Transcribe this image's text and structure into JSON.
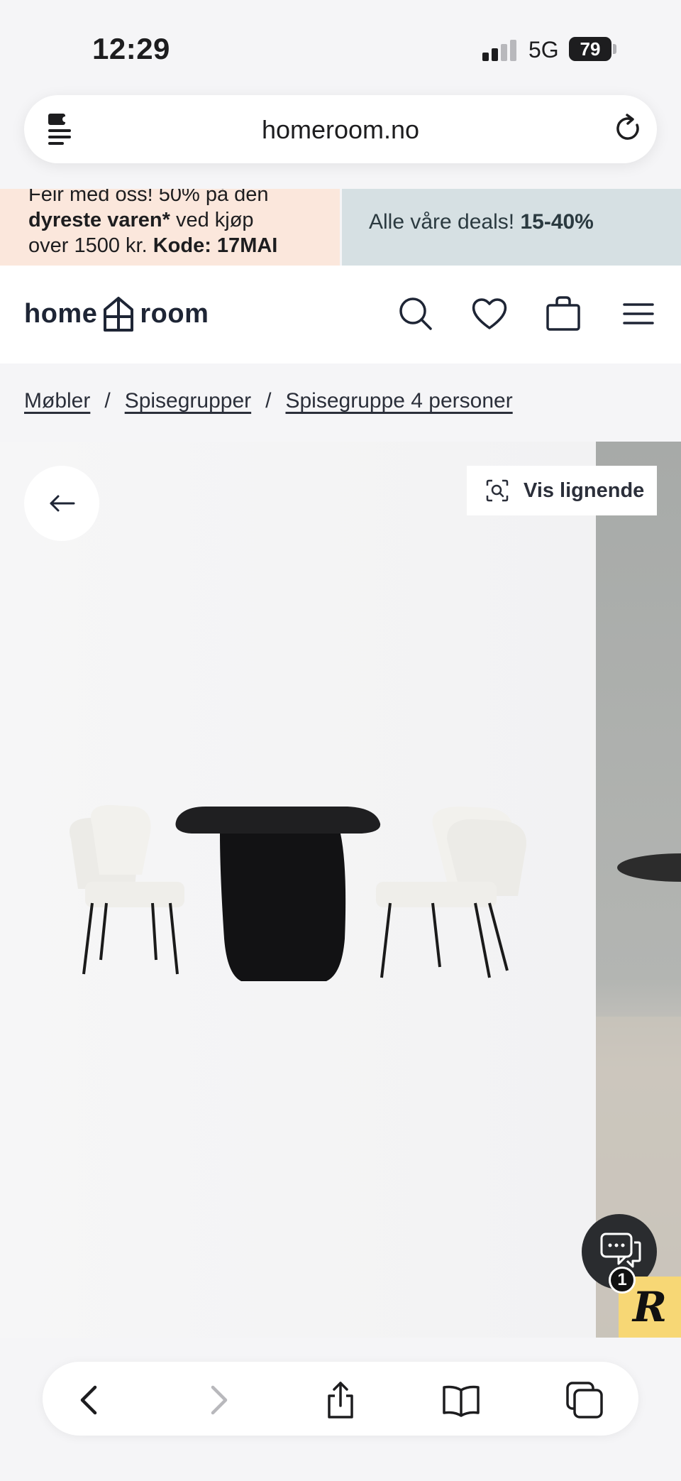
{
  "status_bar": {
    "time": "12:29",
    "network": "5G",
    "battery": "79"
  },
  "browser": {
    "url": "homeroom.no"
  },
  "promo": {
    "left_line1": "Feir med oss! 50% på den",
    "left_line2_bold": "dyreste varen*",
    "left_line2_rest": " ved kjøp",
    "left_line3_rest": "over 1500 kr. ",
    "left_line3_bold": "Kode: 17MAI",
    "right_text": "Alle våre deals! ",
    "right_bold": "15-40%"
  },
  "header": {
    "logo_left": "home",
    "logo_right": "room"
  },
  "breadcrumb": {
    "items": [
      "Møbler",
      "Spisegrupper",
      "Spisegruppe 4 personer"
    ],
    "separator": "/"
  },
  "gallery": {
    "similar_label": "Vis lignende",
    "chat_badge_count": "1",
    "reviews_badge_letter": "R"
  },
  "icons": {
    "search": "search-icon",
    "wishlist": "heart-icon",
    "cart": "bag-icon",
    "menu": "hamburger-icon"
  },
  "colors": {
    "promo_left_bg": "#fbe7dc",
    "promo_right_bg": "#d6e0e3",
    "reviews_badge": "#f7d775"
  }
}
